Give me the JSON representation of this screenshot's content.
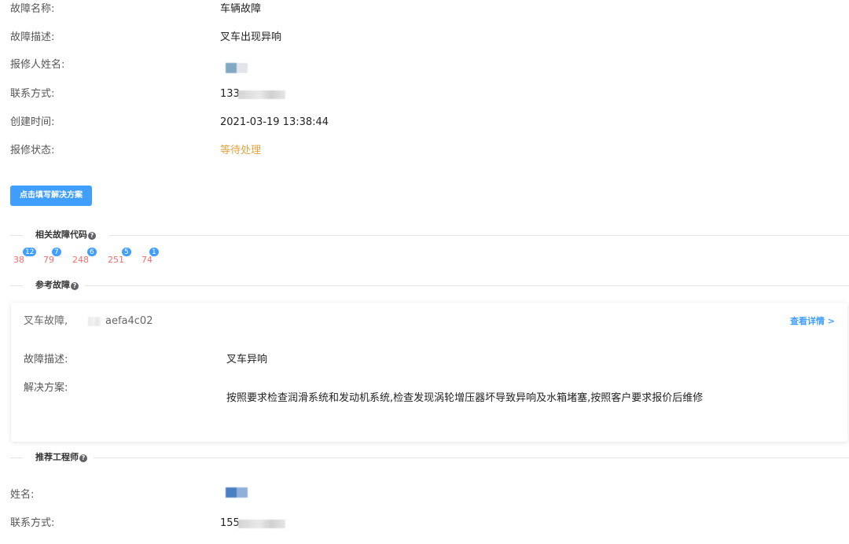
{
  "fault": {
    "name_label": "故障名称:",
    "name_value": "车辆故障",
    "desc_label": "故障描述:",
    "desc_value": "叉车出现异响",
    "reporter_label": "报修人姓名:",
    "contact_label": "联系方式:",
    "contact_value": "133",
    "created_label": "创建时间:",
    "created_value": "2021-03-19 13:38:44",
    "status_label": "报修状态:",
    "status_value": "等待处理",
    "status_color": "#e6a23c"
  },
  "actions": {
    "fill_solution_label": "点击填写解决方案"
  },
  "related_codes": {
    "title": "相关故障代码",
    "icon": "question-circle-icon",
    "items": [
      {
        "code": "38",
        "count": "12"
      },
      {
        "code": "79",
        "count": "7"
      },
      {
        "code": "248",
        "count": "6"
      },
      {
        "code": "251",
        "count": "5"
      },
      {
        "code": "74",
        "count": "1"
      }
    ]
  },
  "reference": {
    "title": "参考故障",
    "icon": "question-circle-icon",
    "card": {
      "title": "叉车故障,",
      "id": "aefa4c02",
      "detail_link": "查看详情 >",
      "desc_label": "故障描述:",
      "desc_value": "叉车异响",
      "solution_label": "解决方案:",
      "solution_value": "按照要求检查润滑系统和发动机系统,检查发现涡轮增压器坏导致异响及水箱堵塞,按照客户要求报价后维修"
    }
  },
  "engineer": {
    "title": "推荐工程师",
    "icon": "question-circle-icon",
    "name_label": "姓名:",
    "contact_label": "联系方式:",
    "contact_value": "155"
  },
  "colors": {
    "primary": "#409eff",
    "code_red": "#f56c6c",
    "warning": "#e6a23c"
  }
}
